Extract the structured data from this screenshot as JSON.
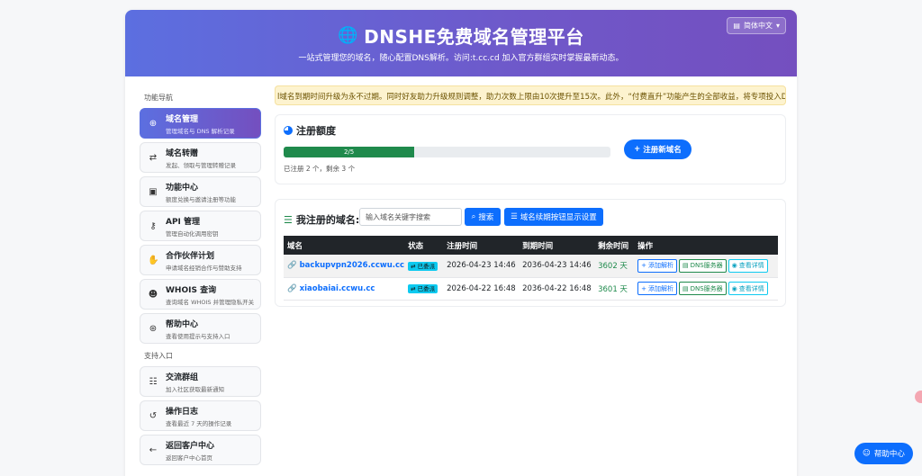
{
  "header": {
    "title": "DNSHE免费域名管理平台",
    "subtitle": "一站式管理您的域名，随心配置DNS解析。访问:t.cc.cd 加入官方群组实时掌握最新动态。",
    "language": "简体中文"
  },
  "sidebar": {
    "section_nav": "功能导航",
    "section_support": "支持入口",
    "items": [
      {
        "label": "域名管理",
        "desc": "管理域名与 DNS 解析记录",
        "icon": "globe-icon"
      },
      {
        "label": "域名转赠",
        "desc": "发起、领取与管理转赠记录",
        "icon": "transfer-icon"
      },
      {
        "label": "功能中心",
        "desc": "额度兑换与邀请注册等功能",
        "icon": "toolbox-icon"
      },
      {
        "label": "API 管理",
        "desc": "管理自动化调用密钥",
        "icon": "key-icon"
      },
      {
        "label": "合作伙伴计划",
        "desc": "申请域名经销合作与赞助支持",
        "icon": "handshake-icon"
      },
      {
        "label": "WHOIS 查询",
        "desc": "查询域名 WHOIS 并管理隐私开关",
        "icon": "user-search-icon"
      },
      {
        "label": "帮助中心",
        "desc": "查看使用提示与支持入口",
        "icon": "lifebuoy-icon"
      }
    ],
    "support_items": [
      {
        "label": "交流群组",
        "desc": "加入社区获取最新通知",
        "icon": "users-icon"
      },
      {
        "label": "操作日志",
        "desc": "查看最近 7 天的操作记录",
        "icon": "history-icon"
      },
      {
        "label": "返回客户中心",
        "desc": "返回客户中心首页",
        "icon": "arrow-left-icon"
      }
    ]
  },
  "notice": "l域名到期时间升级为永不过期。同时好友助力升级规则调整，助力次数上限由10次提升至15次。此外，“付费直升”功能产生的全部收益，将专项投入DN",
  "quota": {
    "title": "注册额度",
    "progress_label": "2/5",
    "progress": 0.4,
    "note": "已注册 2 个，剩余 3 个",
    "register_button": "注册新域名"
  },
  "domains": {
    "title": "我注册的域名:",
    "search_placeholder": "输入域名关键字搜索",
    "search_button": "搜索",
    "settings_button": "域名续期按钮显示设置",
    "columns": [
      "域名",
      "状态",
      "注册时间",
      "到期时间",
      "剩余时间",
      "操作"
    ],
    "rows": [
      {
        "domain": "backupvpn2026.ccwu.cc",
        "status": "已委派",
        "registered": "2026-04-23 14:46",
        "expires": "2036-04-23 14:46",
        "remaining": "3602 天"
      },
      {
        "domain": "xiaobaiai.ccwu.cc",
        "status": "已委派",
        "registered": "2026-04-22 16:48",
        "expires": "2036-04-22 16:48",
        "remaining": "3601 天"
      }
    ],
    "actions": {
      "add": "添加解析",
      "dns": "DNS服务器",
      "detail": "查看详情"
    }
  },
  "help_float": "帮助中心"
}
